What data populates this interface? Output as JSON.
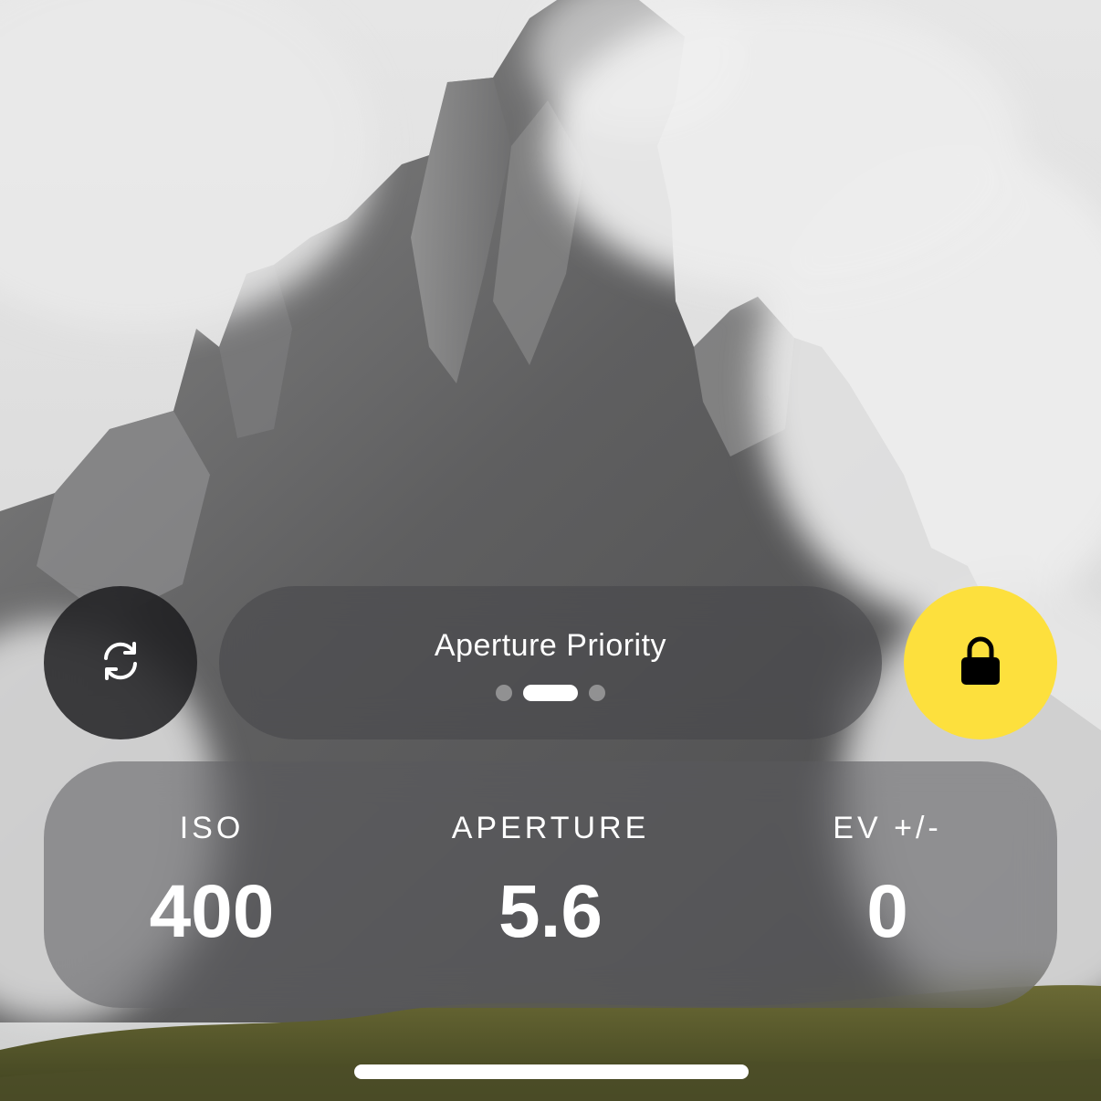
{
  "mode": {
    "label": "Aperture Priority",
    "page_count": 3,
    "active_page": 2
  },
  "buttons": {
    "switch_icon": "refresh-icon",
    "lock_icon": "lock-icon"
  },
  "settings": [
    {
      "label": "ISO",
      "value": "400"
    },
    {
      "label": "APERTURE",
      "value": "5.6"
    },
    {
      "label": "EV +/-",
      "value": "0"
    }
  ],
  "colors": {
    "accent": "#fde03d",
    "text": "#ffffff"
  }
}
